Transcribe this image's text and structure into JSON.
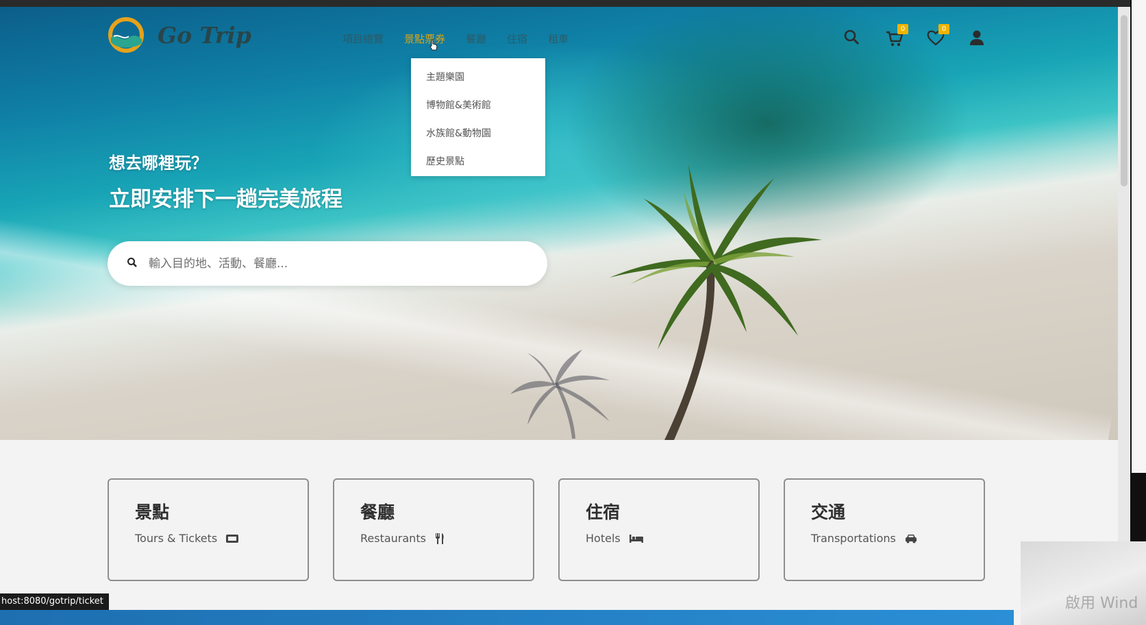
{
  "brand": {
    "name": "Go Trip"
  },
  "nav": {
    "items": [
      {
        "label": "項目總覽"
      },
      {
        "label": "景點票券"
      },
      {
        "label": "餐廳"
      },
      {
        "label": "住宿"
      },
      {
        "label": "租車"
      }
    ],
    "active_index": 1
  },
  "header_icons": {
    "cart_count": "0",
    "wishlist_count": "0"
  },
  "dropdown": {
    "items": [
      "主題樂園",
      "博物館&美術館",
      "水族館&動物園",
      "歷史景點"
    ]
  },
  "hero": {
    "tagline": "想去哪裡玩？",
    "headline": "立即安排下一趟完美旅程",
    "search_placeholder": "輸入目的地、活動、餐廳..."
  },
  "categories": [
    {
      "title": "景點",
      "subtitle": "Tours & Tickets",
      "icon": "ticket-icon"
    },
    {
      "title": "餐廳",
      "subtitle": "Restaurants",
      "icon": "utensils-icon"
    },
    {
      "title": "住宿",
      "subtitle": "Hotels",
      "icon": "bed-icon"
    },
    {
      "title": "交通",
      "subtitle": "Transportations",
      "icon": "car-icon"
    }
  ],
  "status_bar": {
    "url": "host:8080/gotrip/ticket"
  },
  "overlay": {
    "watermark": "啟用 Wind"
  },
  "colors": {
    "accent": "#d9a316",
    "badge": "#f0b400",
    "card_border": "#8e8e8e"
  }
}
